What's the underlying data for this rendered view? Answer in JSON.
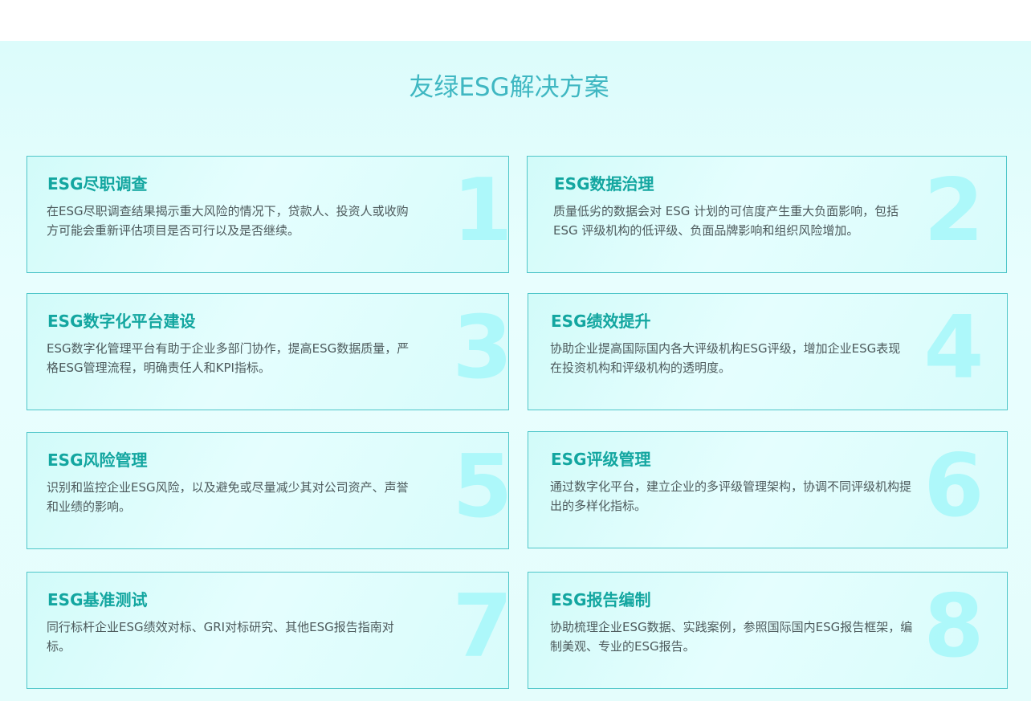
{
  "section": {
    "title": "友绿ESG解决方案"
  },
  "cards": [
    {
      "number": "1",
      "title": "ESG尽职调查",
      "description": "在ESG尽职调查结果揭示重大风险的情况下，贷款人、投资人或收购方可能会重新评估项目是否可行以及是否继续。"
    },
    {
      "number": "2",
      "title": "ESG数据治理",
      "description": "质量低劣的数据会对 ESG 计划的可信度产生重大负面影响，包括 ESG 评级机构的低评级、负面品牌影响和组织风险增加。"
    },
    {
      "number": "3",
      "title": "ESG数字化平台建设",
      "description": "ESG数字化管理平台有助于企业多部门协作，提高ESG数据质量，严格ESG管理流程，明确责任人和KPI指标。"
    },
    {
      "number": "4",
      "title": "ESG绩效提升",
      "description": "协助企业提高国际国内各大评级机构ESG评级，增加企业ESG表现在投资机构和评级机构的透明度。"
    },
    {
      "number": "5",
      "title": "ESG风险管理",
      "description": "识别和监控企业ESG风险，以及避免或尽量减少其对公司资产、声誉和业绩的影响。"
    },
    {
      "number": "6",
      "title": "ESG评级管理",
      "description": "通过数字化平台，建立企业的多评级管理架构，协调不同评级机构提出的多样化指标。"
    },
    {
      "number": "7",
      "title": "ESG基准测试",
      "description": "同行标杆企业ESG绩效对标、GRI对标研究、其他ESG报告指南对标。"
    },
    {
      "number": "8",
      "title": "ESG报告编制",
      "description": "协助梳理企业ESG数据、实践案例，参照国际国内ESG报告框架，编制美观、专业的ESG报告。"
    }
  ]
}
